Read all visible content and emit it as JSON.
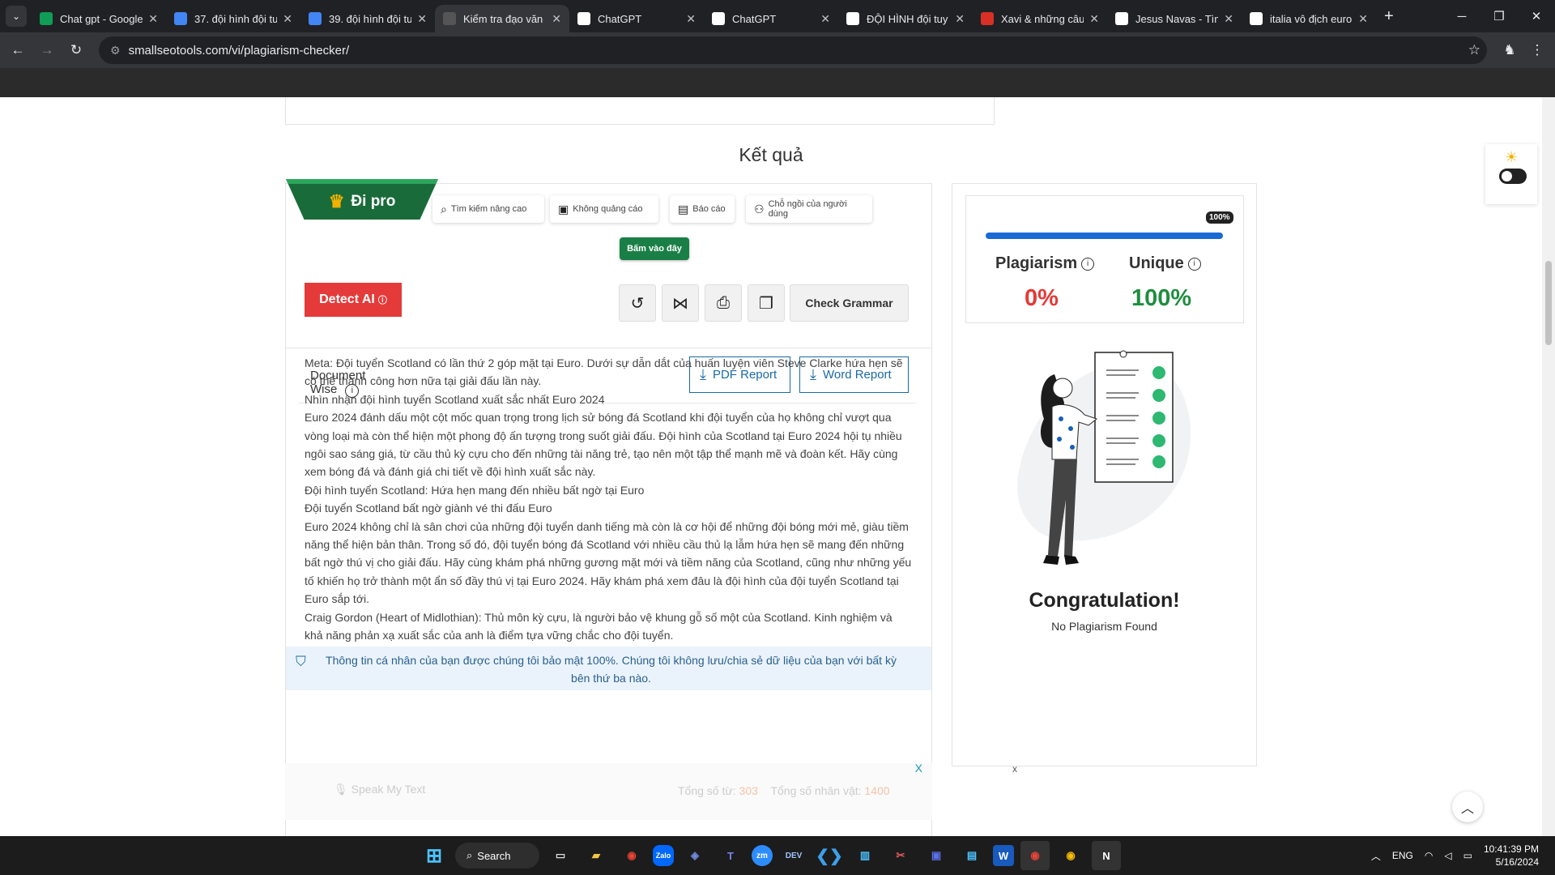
{
  "browser": {
    "tabs": [
      {
        "title": "Chat gpt - Google",
        "icon": "sheets-icon",
        "color": "#0f9d58",
        "active": false
      },
      {
        "title": "37. đội hình đội tu",
        "icon": "docs-icon",
        "color": "#4285f4",
        "active": false
      },
      {
        "title": "39. đội hình đội tu",
        "icon": "docs-icon",
        "color": "#4285f4",
        "active": false
      },
      {
        "title": "Kiểm tra đạo văn",
        "icon": "sst-icon",
        "color": "#555555",
        "active": true
      },
      {
        "title": "ChatGPT",
        "icon": "openai-icon",
        "color": "#ffffff",
        "active": false
      },
      {
        "title": "ChatGPT",
        "icon": "openai-icon",
        "color": "#ffffff",
        "active": false
      },
      {
        "title": "ĐỘI HÌNH đội tuy",
        "icon": "google-icon",
        "color": "#ffffff",
        "active": false
      },
      {
        "title": "Xavi & những câu",
        "icon": "bookmark-icon",
        "color": "#d93025",
        "active": false
      },
      {
        "title": "Jesus Navas - Tìm",
        "icon": "google-icon",
        "color": "#ffffff",
        "active": false
      },
      {
        "title": "italia vô địch euro",
        "icon": "google-icon",
        "color": "#ffffff",
        "active": false
      }
    ],
    "url": "smallseotools.com/vi/plagiarism-checker/"
  },
  "page": {
    "heading": "Kết quả",
    "go_pro": "Đi pro",
    "features": [
      "Tìm kiếm nâng cao",
      "Không quảng cáo",
      "Báo cáo",
      "Chỗ ngồi của người dùng"
    ],
    "click_here": "Bấm vào đây",
    "detect_ai": "Detect AI",
    "check_grammar": "Check Grammar",
    "document_wise": "Document Wise",
    "pdf_report": "PDF Report",
    "word_report": "Word Report",
    "content_lines": [
      "Meta: Đội tuyển Scotland có lần thứ 2 góp mặt tại Euro. Dưới sự dẫn dắt của huấn luyện viên Steve Clarke hứa hẹn sẽ có thể thành công hơn nữa tại giải đấu lần này.",
      "Nhìn nhận đội hình tuyển Scotland xuất sắc nhất Euro 2024",
      "Euro 2024 đánh dấu một cột mốc quan trọng trong lịch sử bóng đá Scotland khi đội tuyển của họ không chỉ vượt qua vòng loại mà còn thể hiện một phong độ ấn tượng trong suốt giải đấu. Đội hình của Scotland tại Euro 2024 hội tụ nhiều ngôi sao sáng giá, từ cầu thủ kỳ cựu cho đến những tài năng trẻ, tạo nên một tập thể mạnh mẽ và đoàn kết. Hãy cùng xem bóng đá và đánh giá chi tiết về đội hình xuất sắc này.",
      "Đội hình tuyển Scotland: Hứa hẹn mang đến nhiều bất ngờ tại Euro",
      "Đội tuyển Scotland bất ngờ giành vé thi đấu Euro",
      "Euro 2024 không chỉ là sân chơi của những đội tuyển danh tiếng mà còn là cơ hội để những đội bóng mới mẻ, giàu tiềm năng thể hiện bản thân. Trong số đó, đội tuyển bóng đá Scotland với nhiều cầu thủ lạ lẫm hứa hẹn sẽ mang đến những bất ngờ thú vị cho giải đấu. Hãy cùng khám phá những gương mặt mới và tiềm năng của Scotland, cũng như những yếu tố khiến họ trở thành một ẩn số đầy thú vị tại Euro 2024. Hãy khám phá xem đâu là đội hình của đội tuyển Scotland tại Euro sắp tới.",
      "Craig Gordon (Heart of Midlothian): Thủ môn kỳ cựu, là người bảo vệ khung gỗ số một của Scotland. Kinh nghiệm và khả năng phản xạ xuất sắc của anh là điểm tựa vững chắc cho đội tuyển."
    ],
    "privacy_note": "Thông tin cá nhân của bạn được chúng tôi bảo mật 100%. Chúng tôi không lưu/chia sẻ dữ liệu của bạn với bất kỳ bên thứ ba nào.",
    "speak": "Speak My Text",
    "word_count_label": "Tổng số từ:",
    "word_count": "303",
    "char_count_label": "Tổng số nhân vật:",
    "char_count": "1400",
    "ad_close": "X",
    "ad_close2": "x"
  },
  "result": {
    "progress_label": "100%",
    "progress": 1.0,
    "plagiarism_label": "Plagiarism",
    "plagiarism_value": "0%",
    "unique_label": "Unique",
    "unique_value": "100%",
    "congrats": "Congratulation!",
    "no_plag": "No Plagiarism Found",
    "colors": {
      "plagiarism": "#e53935",
      "unique": "#1e8e3e",
      "bar": "#1a6ad6"
    }
  },
  "taskbar": {
    "search": "Search",
    "lang": "ENG",
    "time": "10:41:39 PM",
    "date": "5/16/2024"
  }
}
